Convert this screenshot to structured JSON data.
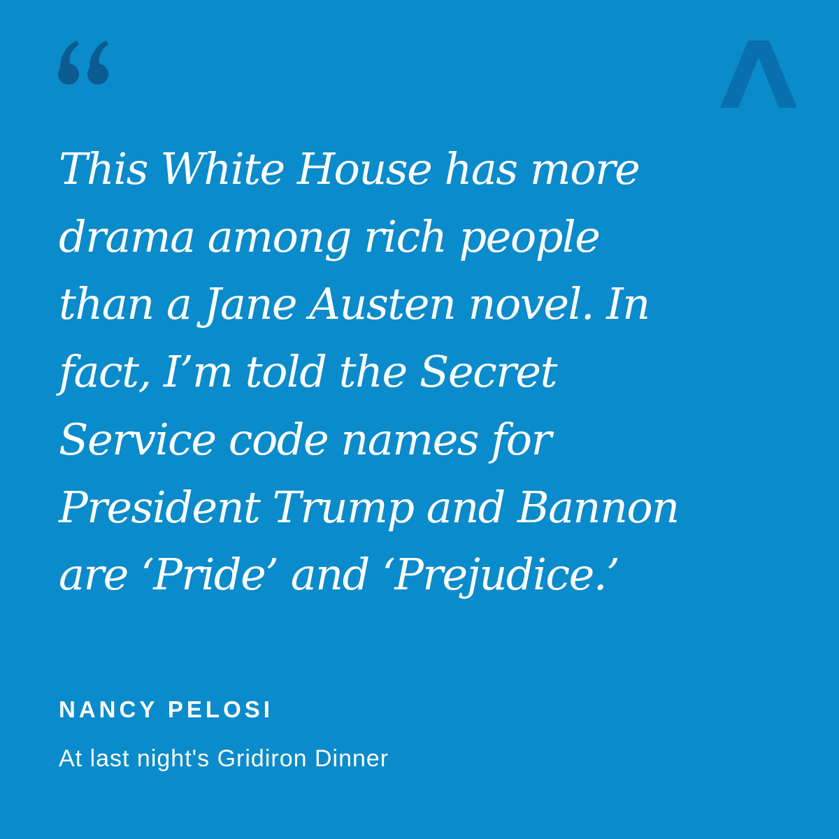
{
  "colors": {
    "background": "#0a8bcb",
    "quote_mark": "#0b5b91",
    "logo": "#0a6fae",
    "text": "#ffffff"
  },
  "icons": {
    "quote_mark": "open-double-quote-icon",
    "logo": "chevron-a-logo"
  },
  "quote": {
    "lines": [
      "This White House has more",
      "drama among rich people",
      "than a Jane Austen novel. In",
      "fact, I’m told the Secret",
      "Service code names for",
      "President Trump and Bannon",
      "are ‘Pride’ and ‘Prejudice.’"
    ]
  },
  "attribution": {
    "speaker": "NANCY PELOSI",
    "context": "At last night's Gridiron Dinner"
  }
}
